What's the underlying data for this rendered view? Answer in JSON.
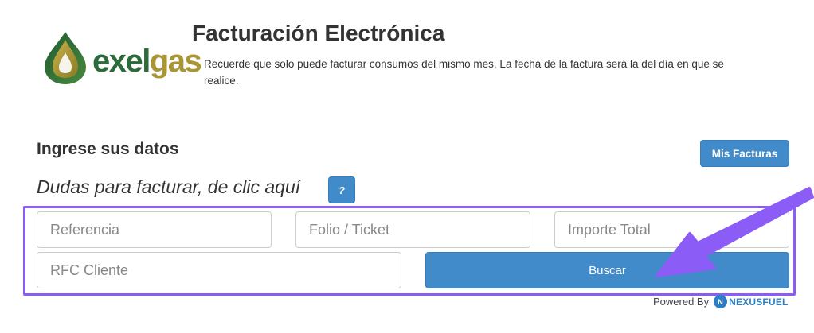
{
  "logo": {
    "text_a": "exel",
    "text_b": "gas"
  },
  "header": {
    "title": "Facturación Electrónica",
    "subtitle": "Recuerde que solo puede facturar consumos del mismo mes. La fecha de la factura será la del día en que se realice."
  },
  "form": {
    "section_title": "Ingrese sus datos",
    "help_text": "Dudas para facturar, de clic aquí",
    "help_button": "?",
    "mis_facturas_button": "Mis Facturas",
    "fields": {
      "referencia": {
        "placeholder": "Referencia",
        "value": ""
      },
      "folio": {
        "placeholder": "Folio / Ticket",
        "value": ""
      },
      "importe": {
        "placeholder": "Importe Total",
        "value": ""
      },
      "rfc": {
        "placeholder": "RFC Cliente",
        "value": ""
      }
    },
    "search_button": "Buscar"
  },
  "footer": {
    "powered_by": "Powered By",
    "brand": "NEXUSFUEL",
    "brand_icon": "nexusfuel-icon"
  },
  "colors": {
    "primary": "#428bca",
    "highlight": "#8b5cf6",
    "logo_green": "#2e6b3a",
    "logo_gold": "#a89533"
  }
}
